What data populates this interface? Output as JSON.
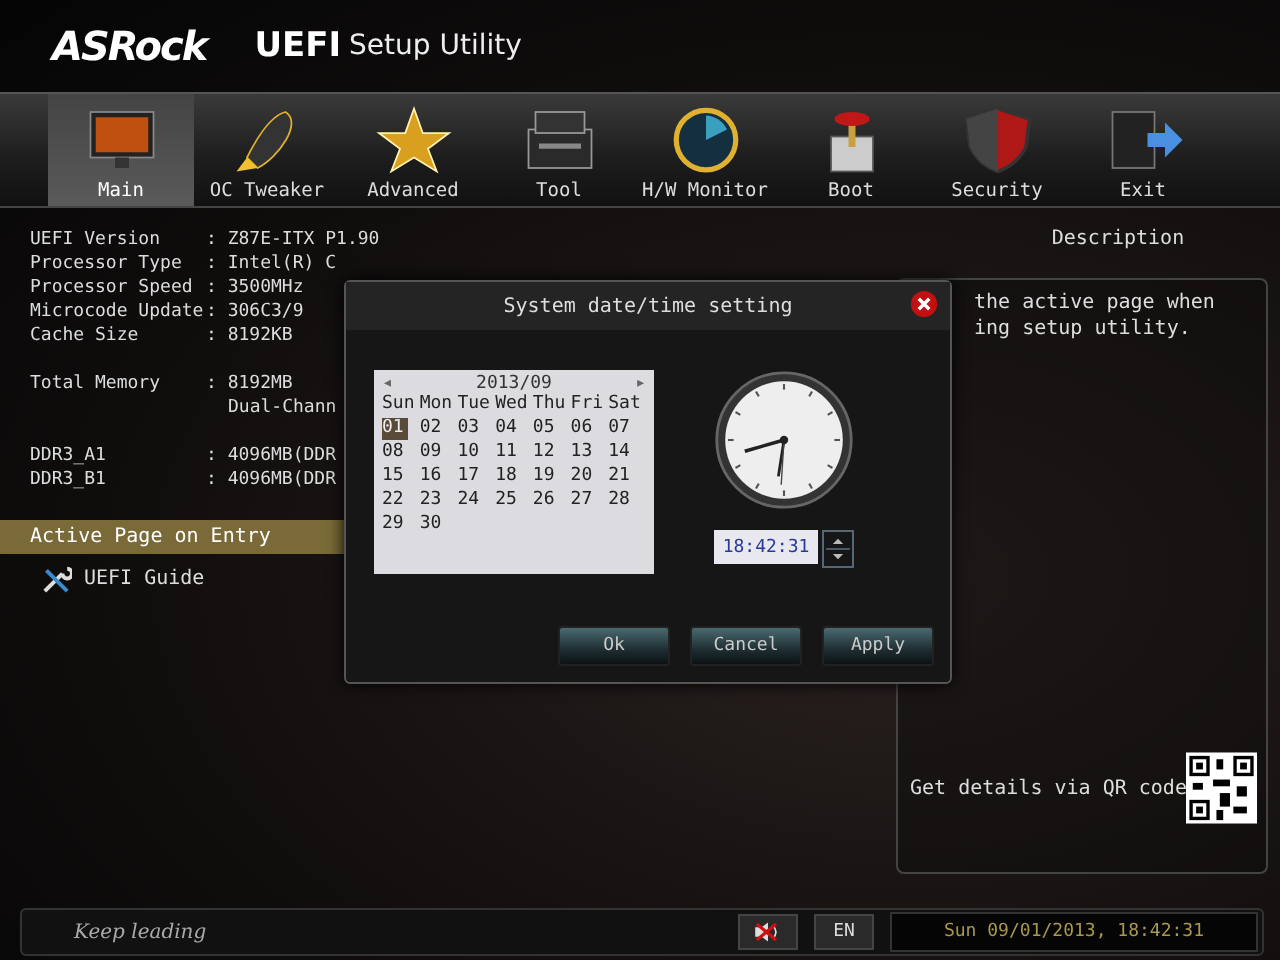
{
  "header": {
    "brand": "ASRock",
    "product": "UEFI",
    "subtitle": "Setup Utility"
  },
  "nav": [
    {
      "label": "Main",
      "selected": true
    },
    {
      "label": "OC Tweaker",
      "selected": false
    },
    {
      "label": "Advanced",
      "selected": false
    },
    {
      "label": "Tool",
      "selected": false
    },
    {
      "label": "H/W Monitor",
      "selected": false
    },
    {
      "label": "Boot",
      "selected": false
    },
    {
      "label": "Security",
      "selected": false
    },
    {
      "label": "Exit",
      "selected": false
    }
  ],
  "info": [
    [
      {
        "label": "UEFI Version",
        "value": ": Z87E-ITX P1.90"
      },
      {
        "label": "Processor Type",
        "value": ": Intel(R) C"
      },
      {
        "label": "Processor Speed",
        "value": ": 3500MHz"
      },
      {
        "label": "Microcode Update",
        "value": ": 306C3/9"
      },
      {
        "label": "Cache Size",
        "value": ": 8192KB"
      }
    ],
    [
      {
        "label": "Total Memory",
        "value": ": 8192MB"
      },
      {
        "value": "Dual-Chann"
      }
    ],
    [
      {
        "label": "DDR3_A1",
        "value": ": 4096MB(DDR"
      },
      {
        "label": "DDR3_B1",
        "value": ": 4096MB(DDR"
      }
    ]
  ],
  "menu": [
    {
      "label": "Active Page on Entry",
      "selected": true,
      "kind": "option"
    },
    {
      "label": "UEFI Guide",
      "selected": false,
      "kind": "guide"
    }
  ],
  "description": {
    "title": "Description",
    "lines": [
      "the active page when",
      "ing setup utility."
    ],
    "qr_label": "Get details via QR code"
  },
  "dialog": {
    "title": "System date/time setting",
    "month": "2013/09",
    "prev": "◂",
    "next": "▸",
    "weekdays": [
      "Sun",
      "Mon",
      "Tue",
      "Wed",
      "Thu",
      "Fri",
      "Sat"
    ],
    "days": [
      {
        "label": "01",
        "selected": true
      },
      {
        "label": "02",
        "selected": false
      },
      {
        "label": "03",
        "selected": false
      },
      {
        "label": "04",
        "selected": false
      },
      {
        "label": "05",
        "selected": false
      },
      {
        "label": "06",
        "selected": false
      },
      {
        "label": "07",
        "selected": false
      },
      {
        "label": "08",
        "selected": false
      },
      {
        "label": "09",
        "selected": false
      },
      {
        "label": "10",
        "selected": false
      },
      {
        "label": "11",
        "selected": false
      },
      {
        "label": "12",
        "selected": false
      },
      {
        "label": "13",
        "selected": false
      },
      {
        "label": "14",
        "selected": false
      },
      {
        "label": "15",
        "selected": false
      },
      {
        "label": "16",
        "selected": false
      },
      {
        "label": "17",
        "selected": false
      },
      {
        "label": "18",
        "selected": false
      },
      {
        "label": "19",
        "selected": false
      },
      {
        "label": "20",
        "selected": false
      },
      {
        "label": "21",
        "selected": false
      },
      {
        "label": "22",
        "selected": false
      },
      {
        "label": "23",
        "selected": false
      },
      {
        "label": "24",
        "selected": false
      },
      {
        "label": "25",
        "selected": false
      },
      {
        "label": "26",
        "selected": false
      },
      {
        "label": "27",
        "selected": false
      },
      {
        "label": "28",
        "selected": false
      },
      {
        "label": "29",
        "selected": false
      },
      {
        "label": "30",
        "selected": false
      }
    ],
    "time": "18:42:31",
    "buttons": [
      "Ok",
      "Cancel",
      "Apply"
    ]
  },
  "footer": {
    "slogan": "Keep leading",
    "language": "EN",
    "datetime": "Sun 09/01/2013, 18:42:31"
  }
}
